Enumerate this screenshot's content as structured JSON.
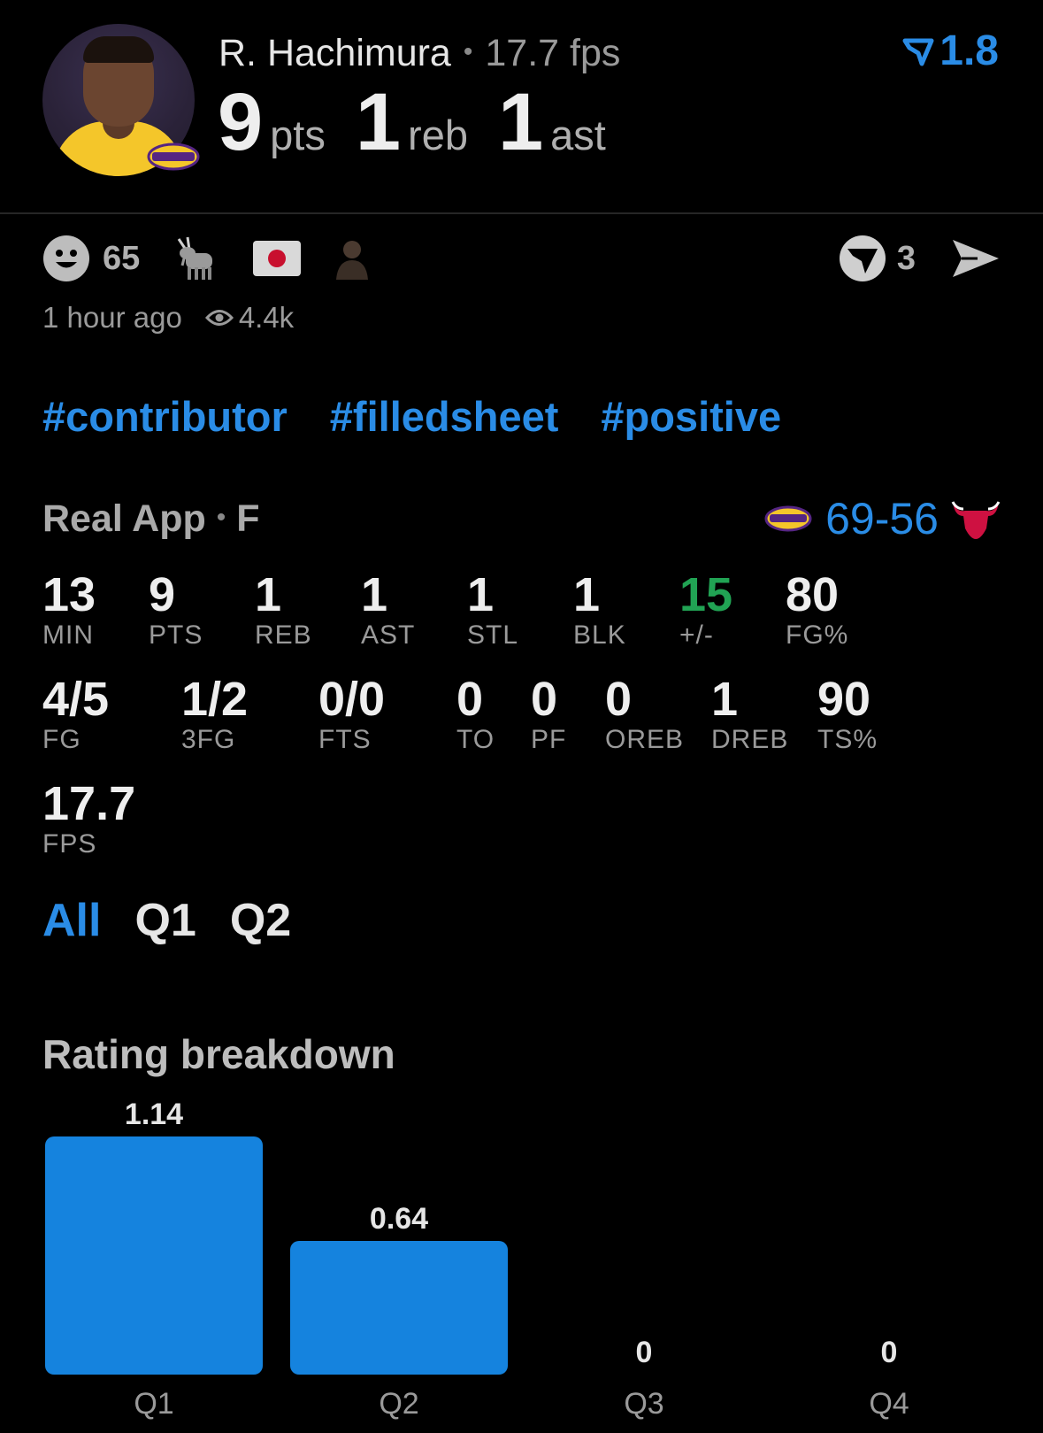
{
  "header": {
    "player_name": "R. Hachimura",
    "fps_text": "17.7 fps",
    "pts_value": "9",
    "pts_label": "pts",
    "reb_value": "1",
    "reb_label": "reb",
    "ast_value": "1",
    "ast_label": "ast",
    "rating_value": "1.8"
  },
  "reactions": {
    "smiley_count": "65",
    "icons": [
      "smiley-icon",
      "goat-icon",
      "japan-flag-icon",
      "person-emoji-icon"
    ],
    "vote_count": "3"
  },
  "meta": {
    "time_ago": "1 hour ago",
    "views": "4.4k"
  },
  "tags": [
    "#contributor",
    "#filledsheet",
    "#positive"
  ],
  "game": {
    "source": "Real App",
    "status": "F",
    "score_home": "69",
    "score_sep": "-",
    "score_away": "56"
  },
  "stats": {
    "row1": [
      {
        "value": "13",
        "label": "MIN"
      },
      {
        "value": "9",
        "label": "PTS"
      },
      {
        "value": "1",
        "label": "REB"
      },
      {
        "value": "1",
        "label": "AST"
      },
      {
        "value": "1",
        "label": "STL"
      },
      {
        "value": "1",
        "label": "BLK"
      },
      {
        "value": "15",
        "label": "+/-"
      },
      {
        "value": "80",
        "label": "FG%"
      }
    ],
    "row2": [
      {
        "value": "4/5",
        "label": "FG"
      },
      {
        "value": "1/2",
        "label": "3FG"
      },
      {
        "value": "0/0",
        "label": "FTS"
      },
      {
        "value": "0",
        "label": "TO"
      },
      {
        "value": "0",
        "label": "PF"
      },
      {
        "value": "0",
        "label": "OREB"
      },
      {
        "value": "1",
        "label": "DREB"
      },
      {
        "value": "90",
        "label": "TS%"
      }
    ],
    "row3": [
      {
        "value": "17.7",
        "label": "FPS"
      }
    ]
  },
  "period_tabs": [
    "All",
    "Q1",
    "Q2"
  ],
  "colors": {
    "accent": "#2a8ce6",
    "bar": "#1583de",
    "positive": "#21a354",
    "background": "#000000"
  },
  "chart_title": "Rating breakdown",
  "chart_data": {
    "type": "bar",
    "categories": [
      "Q1",
      "Q2",
      "Q3",
      "Q4"
    ],
    "values": [
      1.14,
      0.64,
      0,
      0
    ],
    "value_labels": [
      "1.14",
      "0.64",
      "0",
      "0"
    ],
    "title": "Rating breakdown",
    "xlabel": "",
    "ylabel": "",
    "ylim": [
      0,
      1.14
    ],
    "grid": false,
    "legend": "none"
  }
}
